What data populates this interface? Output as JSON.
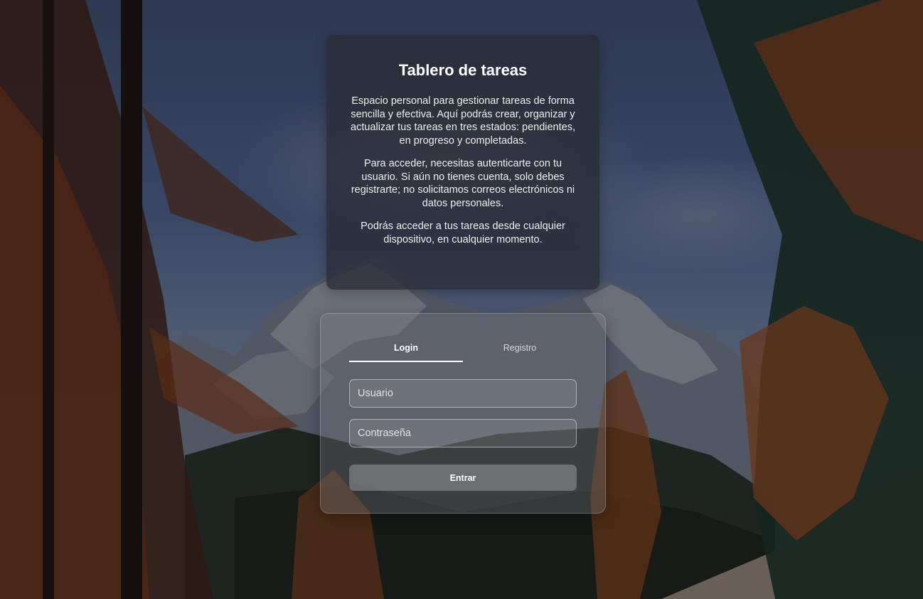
{
  "info": {
    "title": "Tablero de tareas",
    "paragraphs": [
      "Espacio personal para gestionar tareas de forma sencilla y efectiva. Aquí podrás crear, organizar y actualizar tus tareas en tres estados: pendientes, en progreso y completadas.",
      "Para acceder, necesitas autenticarte con tu usuario. Si aún no tienes cuenta, solo debes registrarte; no solicitamos correos electrónicos ni datos personales.",
      "Podrás acceder a tus tareas desde cualquier dispositivo, en cualquier momento."
    ]
  },
  "auth": {
    "tabs": [
      {
        "label": "Login",
        "active": true
      },
      {
        "label": "Registro",
        "active": false
      }
    ],
    "username": {
      "placeholder": "Usuario",
      "value": ""
    },
    "password": {
      "placeholder": "Contraseña",
      "value": ""
    },
    "submit_label": "Entrar"
  },
  "background": {
    "description_icon": "mountain-forest-photo",
    "accent_color": "#c0571f"
  }
}
